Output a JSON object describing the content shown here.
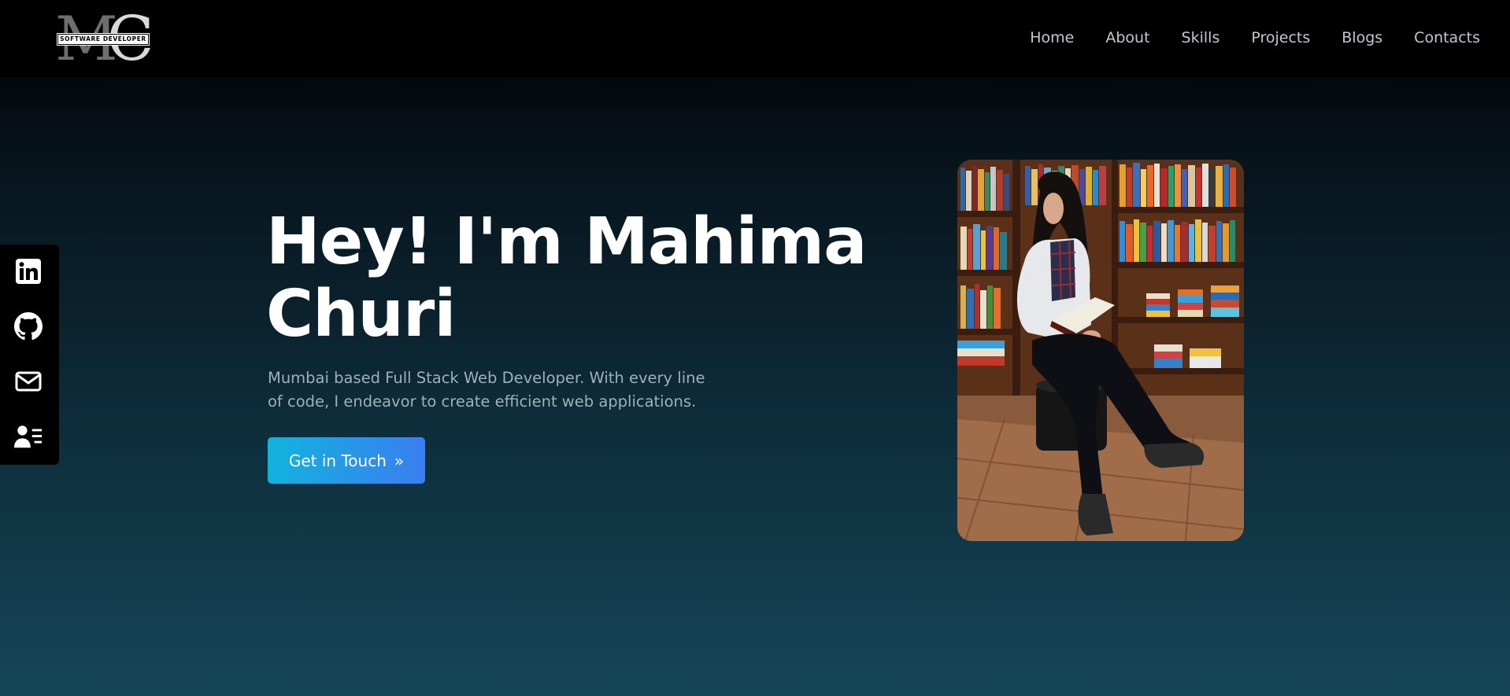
{
  "logo": {
    "letters": "MC",
    "tagline": "SOFTWARE DEVELOPER"
  },
  "nav": {
    "items": [
      {
        "label": "Home"
      },
      {
        "label": "About"
      },
      {
        "label": "Skills"
      },
      {
        "label": "Projects"
      },
      {
        "label": "Blogs"
      },
      {
        "label": "Contacts"
      }
    ]
  },
  "social": {
    "icons": [
      "linkedin-icon",
      "github-icon",
      "mail-icon",
      "resume-icon"
    ]
  },
  "hero": {
    "title_line1": "Hey! I'm Mahima",
    "title_line2": "Churi",
    "subtitle": "Mumbai based Full Stack Web Developer. With every line of code, I endeavor to create efficient web applications.",
    "cta_label": "Get in Touch",
    "cta_icon": "chevrons-right-icon"
  },
  "colors": {
    "navbar": "#000000",
    "accent_start": "#12b3dd",
    "accent_end": "#3a7ef0",
    "text": "#ffffff",
    "muted": "#9eb0bd"
  }
}
